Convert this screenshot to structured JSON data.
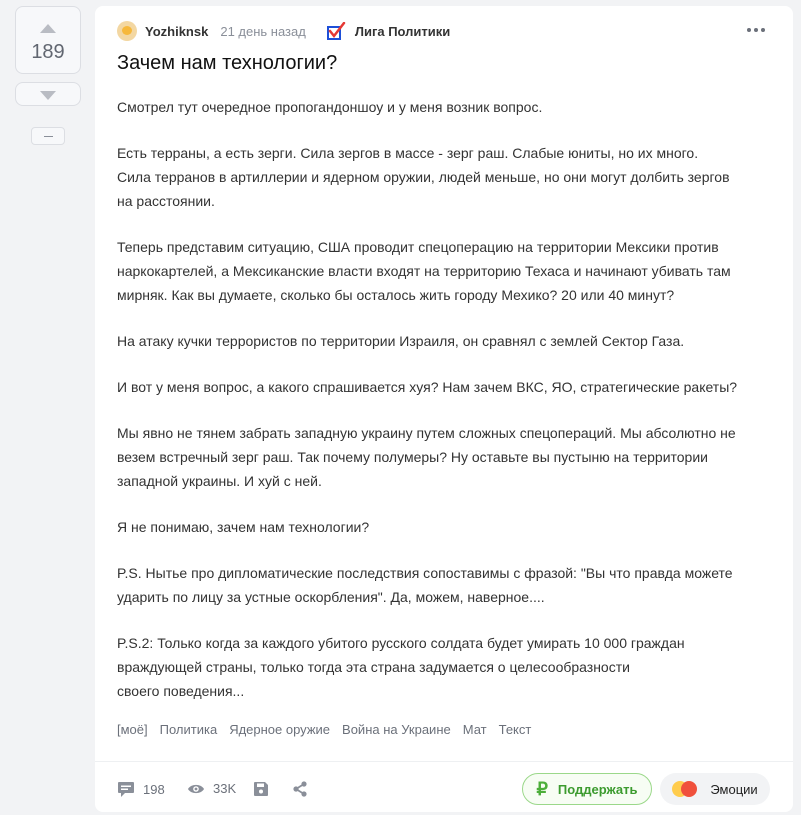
{
  "vote": {
    "rating": "189"
  },
  "post": {
    "author": "Yozhiknsk",
    "time": "21 день назад",
    "community": "Лига Политики",
    "title": "Зачем нам технологии?",
    "paragraphs": [
      [
        "Смотрел тут очередное пропогандоншоу и у меня возник вопрос."
      ],
      [
        "Есть терраны, а есть зерги. Сила зергов в массе - зерг раш. Слабые юниты, но их много.",
        "Сила терранов в артиллерии и ядерном оружии, людей меньше, но они могут долбить зергов",
        "на расстоянии."
      ],
      [
        "Теперь представим ситуацию, США проводит спецоперацию на территории Мексики против",
        "наркокартелей, а Мексиканские власти входят на территорию Техаса и начинают убивать там",
        "мирняк. Как вы думаете, сколько бы осталось жить городу Мехико? 20 или 40 минут?"
      ],
      [
        "На атаку кучки террористов по территории Израиля, он сравнял с землей Сектор Газа."
      ],
      [
        "И вот у меня вопрос, а какого спрашивается хуя? Нам зачем ВКС, ЯО, стратегические ракеты?"
      ],
      [
        "Мы явно не тянем забрать западную украину путем сложных спецопераций. Мы абсолютно не",
        "везем встречный зерг раш. Так почему полумеры? Ну оставьте вы пустыню на территории",
        "западной украины. И хуй с ней."
      ],
      [
        "Я не понимаю, зачем нам технологии?"
      ],
      [
        "P.S. Нытье про дипломатические последствия сопоставимы с фразой: \"Вы что правда можете",
        "ударить по лицу за устные оскорбления\". Да, можем, наверное...."
      ],
      [
        "P.S.2: Только когда за каждого убитого русского солдата будет умирать 10 000 граждан",
        "враждующей страны, только тогда эта страна задумается о целесообразности",
        "своего поведения..."
      ]
    ],
    "tags": [
      "[моё]",
      "Политика",
      "Ядерное оружие",
      "Война на Украине",
      "Мат",
      "Текст"
    ]
  },
  "footer": {
    "comments": "198",
    "views": "33K",
    "support_label": "Поддержать",
    "emotions_label": "Эмоции"
  },
  "colors": {
    "support_green": "#4cae3a",
    "community_blue": "#1d4fd8",
    "community_red": "#e53935"
  }
}
